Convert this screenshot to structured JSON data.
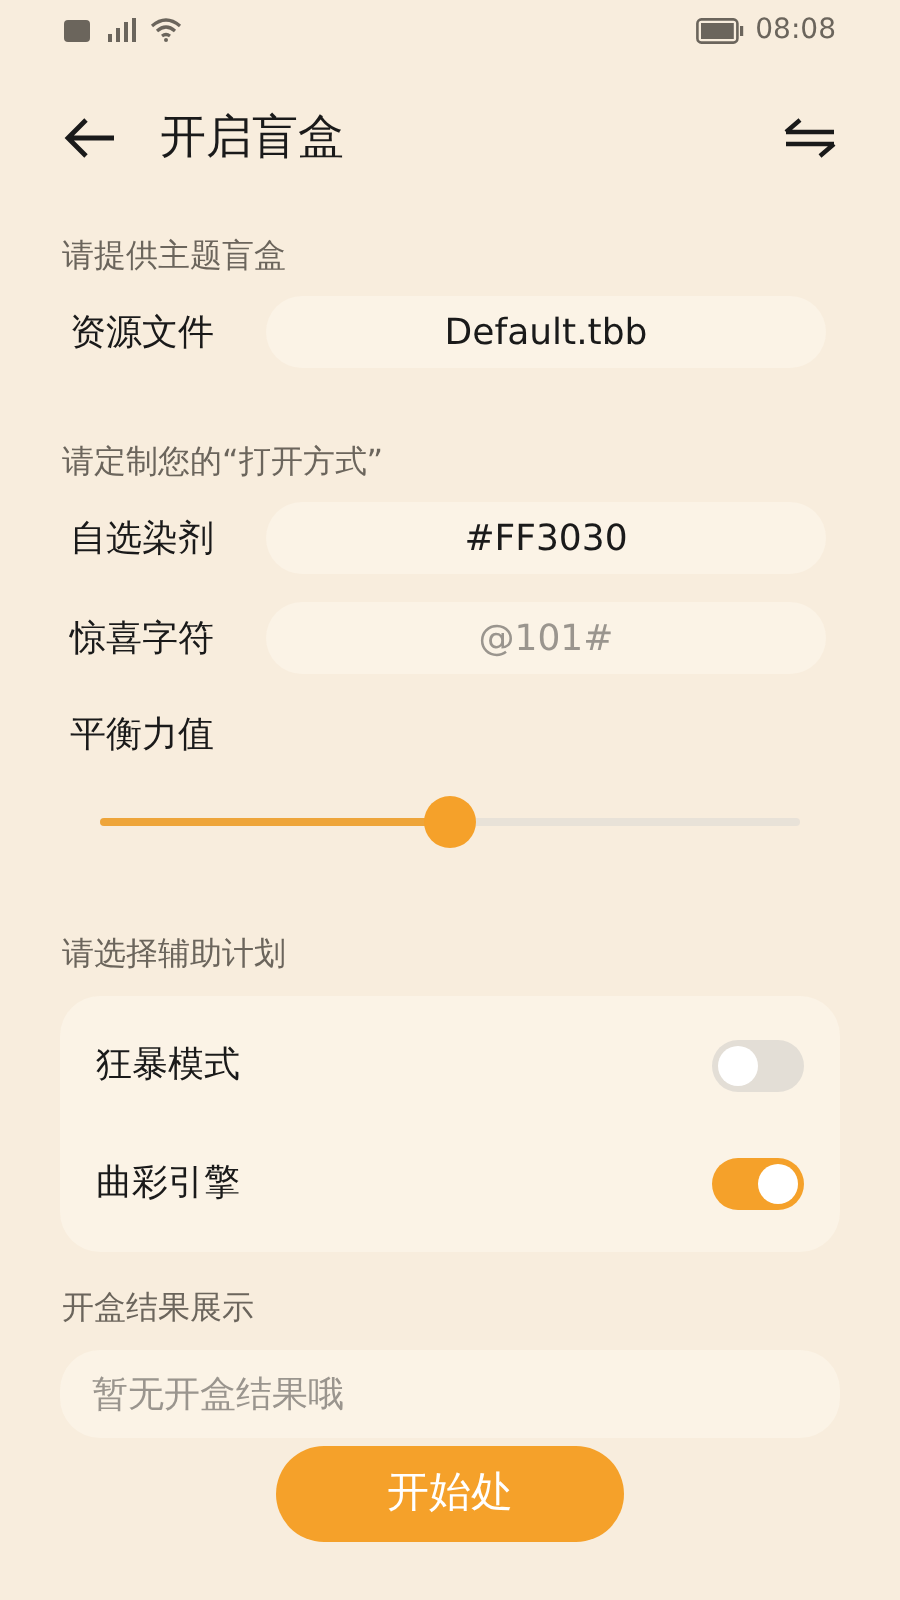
{
  "status_bar": {
    "time": "08:08"
  },
  "header": {
    "title": "开启盲盒"
  },
  "sections": [
    {
      "label": "请提供主题盲盒",
      "fields": [
        {
          "label": "资源文件",
          "value": "Default.tbb",
          "kind": "value"
        }
      ]
    },
    {
      "label": "请定制您的“打开方式”",
      "fields": [
        {
          "label": "自选染剂",
          "value": "#FF3030",
          "kind": "value"
        },
        {
          "label": "惊喜字符",
          "placeholder": "@101#",
          "kind": "placeholder"
        }
      ],
      "slider": {
        "label": "平衡力值",
        "level": 0.5
      }
    },
    {
      "label": "请选择辅助计划",
      "toggles": [
        {
          "label": "狂暴模式",
          "on": false
        },
        {
          "label": "曲彩引擎",
          "on": true
        }
      ]
    },
    {
      "label": "开盒结果展示",
      "result": {
        "placeholder": "暂无开盒结果哦"
      }
    }
  ],
  "action_button": {
    "label": "开始处"
  }
}
